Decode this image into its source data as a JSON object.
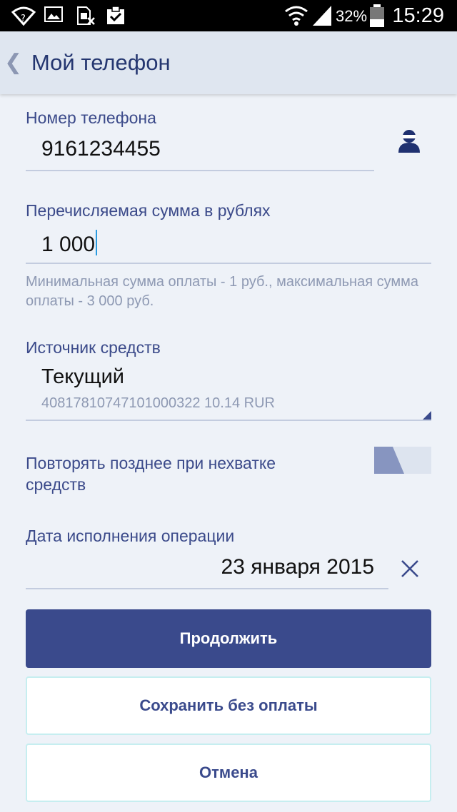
{
  "status_bar": {
    "icons": [
      "wifi-question-icon",
      "image-icon",
      "sim-blocked-icon",
      "clipboard-check-icon",
      "wifi-icon",
      "signal-icon",
      "battery-icon"
    ],
    "battery_percent": "32%",
    "time": "15:29"
  },
  "header": {
    "back_icon": "chevron-left-icon",
    "title": "Мой телефон"
  },
  "phone": {
    "label": "Номер телефона",
    "value": "9161234455",
    "contact_icon": "contact-person-icon"
  },
  "amount": {
    "label": "Перечисляемая сумма в рублях",
    "value": "1 000",
    "hint": "Минимальная сумма оплаты - 1 руб., максимальная сумма оплаты - 3 000 руб."
  },
  "source": {
    "label": "Источник средств",
    "value": "Текущий",
    "account": "40817810747101000322 10.14 RUR"
  },
  "repeat": {
    "label": "Повторять позднее при нехватке средств",
    "enabled": false
  },
  "date": {
    "label": "Дата исполнения операции",
    "value": "23 января 2015",
    "clear_icon": "close-icon"
  },
  "buttons": {
    "continue": "Продолжить",
    "save": "Сохранить без оплаты",
    "cancel": "Отмена"
  },
  "colors": {
    "primary": "#3a4a8c",
    "background": "#eef2f8",
    "label": "#3b4a8a",
    "hint": "#8e99b3"
  }
}
